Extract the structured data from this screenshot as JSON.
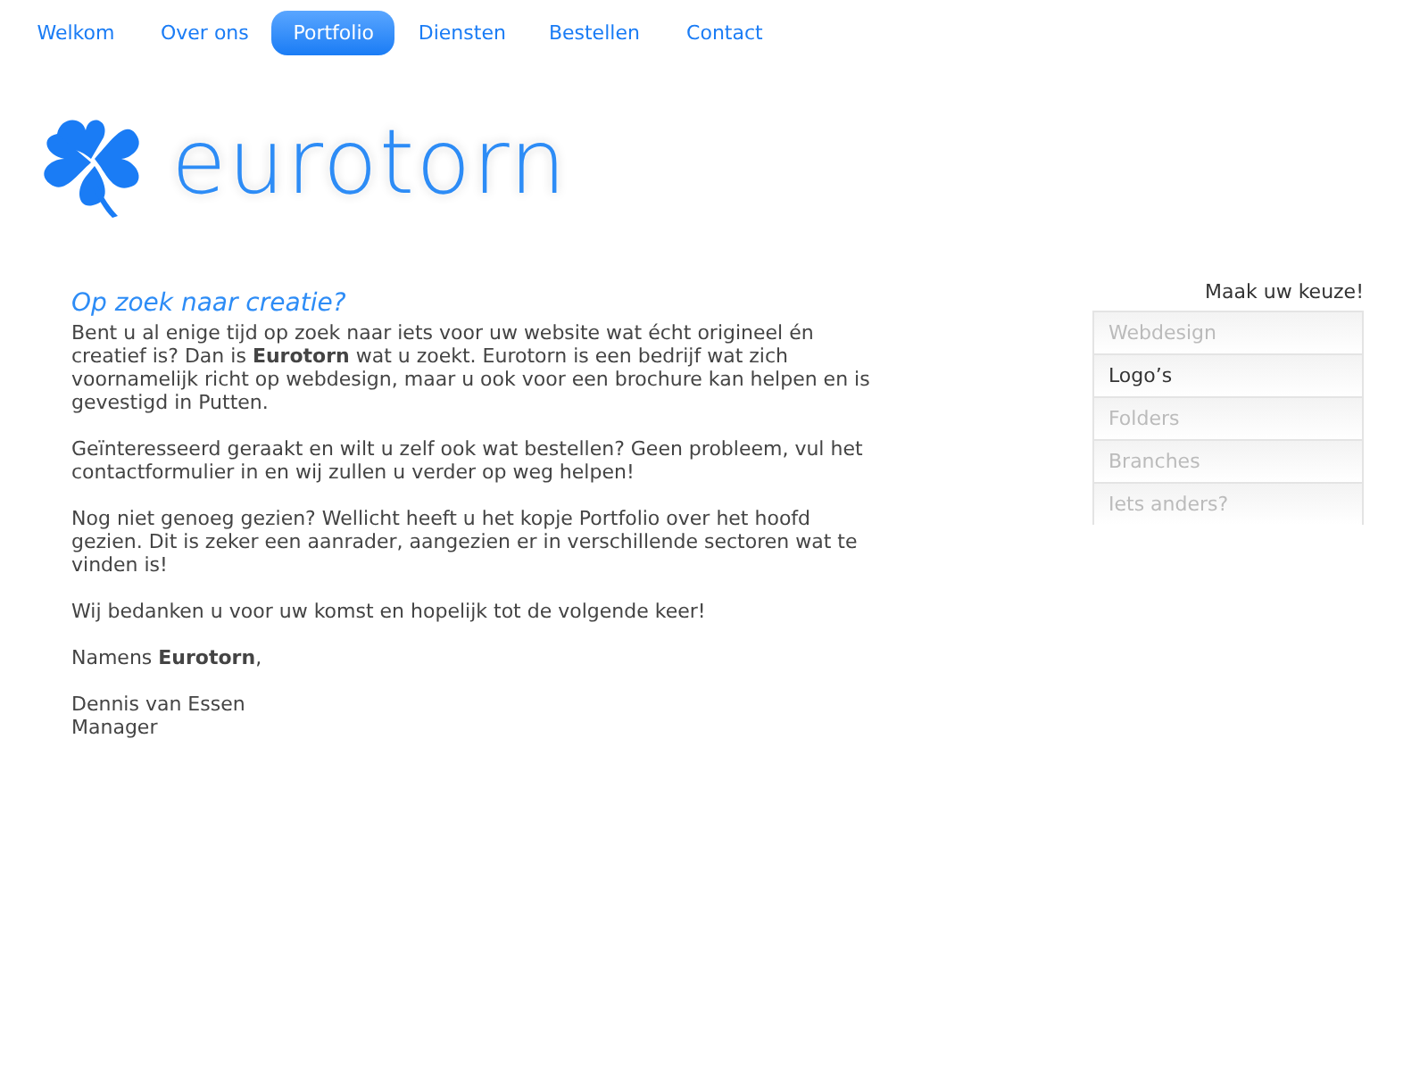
{
  "nav": [
    {
      "label": "Welkom",
      "selected": false
    },
    {
      "label": "Over ons",
      "selected": false
    },
    {
      "label": "Portfolio",
      "selected": true
    },
    {
      "label": "Diensten",
      "selected": false
    },
    {
      "label": "Bestellen",
      "selected": false
    },
    {
      "label": "Contact",
      "selected": false
    }
  ],
  "logo": {
    "text": "eurotorn"
  },
  "article": {
    "heading": "Op zoek naar creatie?",
    "paragraphs": [
      "Bent u al enige tijd op zoek naar iets voor uw website wat écht origineel én creatief is? Dan is **Eurotorn** wat u zoekt. Eurotorn is een bedrijf wat zich voornamelijk richt op webdesign, maar u ook voor een brochure kan helpen en is gevestigd in Putten.",
      "Geïnteresseerd geraakt en wilt u zelf ook wat bestellen? Geen probleem, vul het contactformulier in en wij zullen u verder op weg helpen!",
      "Nog niet genoeg gezien? Wellicht heeft u het kopje Portfolio over het hoofd gezien. Dit is zeker een aanrader, aangezien er in verschillende sectoren wat te vinden is!",
      "Wij bedanken u voor uw komst en hopelijk tot de volgende keer!",
      "Namens **Eurotorn**,"
    ],
    "signature": [
      "Dennis van Essen",
      "Manager"
    ]
  },
  "sidebar": {
    "title": "Maak uw keuze!",
    "items": [
      {
        "label": "Webdesign",
        "selected": false
      },
      {
        "label": "Logo’s",
        "selected": true
      },
      {
        "label": "Folders",
        "selected": false
      },
      {
        "label": "Branches",
        "selected": false
      },
      {
        "label": "Iets anders?",
        "selected": false
      }
    ]
  }
}
